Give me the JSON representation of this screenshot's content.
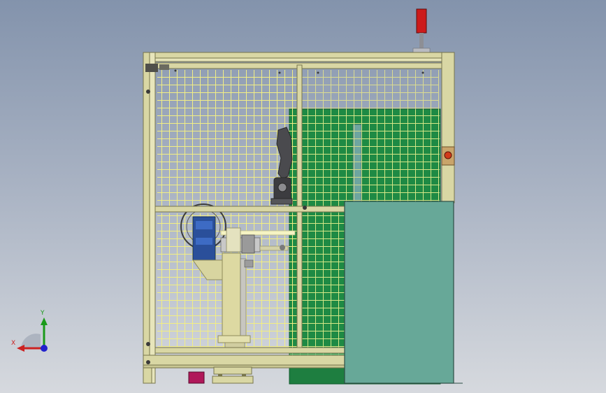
{
  "viewport": {
    "background_top": "#8393ac",
    "background_bottom": "#d6d9de"
  },
  "model": {
    "frame_color": "#d9d7a4",
    "mesh_color": "#f3f08a",
    "panel_color": "#1e8a44",
    "cabinet_color": "#67a898",
    "motor_color": "#2a4f9a",
    "signal_tower_color": "#cc1b1b",
    "emergency_stop_color": "#d13a1a"
  },
  "triad": {
    "x_label": "X",
    "y_label": "Y",
    "x_color": "#cc2222",
    "y_color": "#1a9a1a",
    "z_color": "#2222cc"
  }
}
